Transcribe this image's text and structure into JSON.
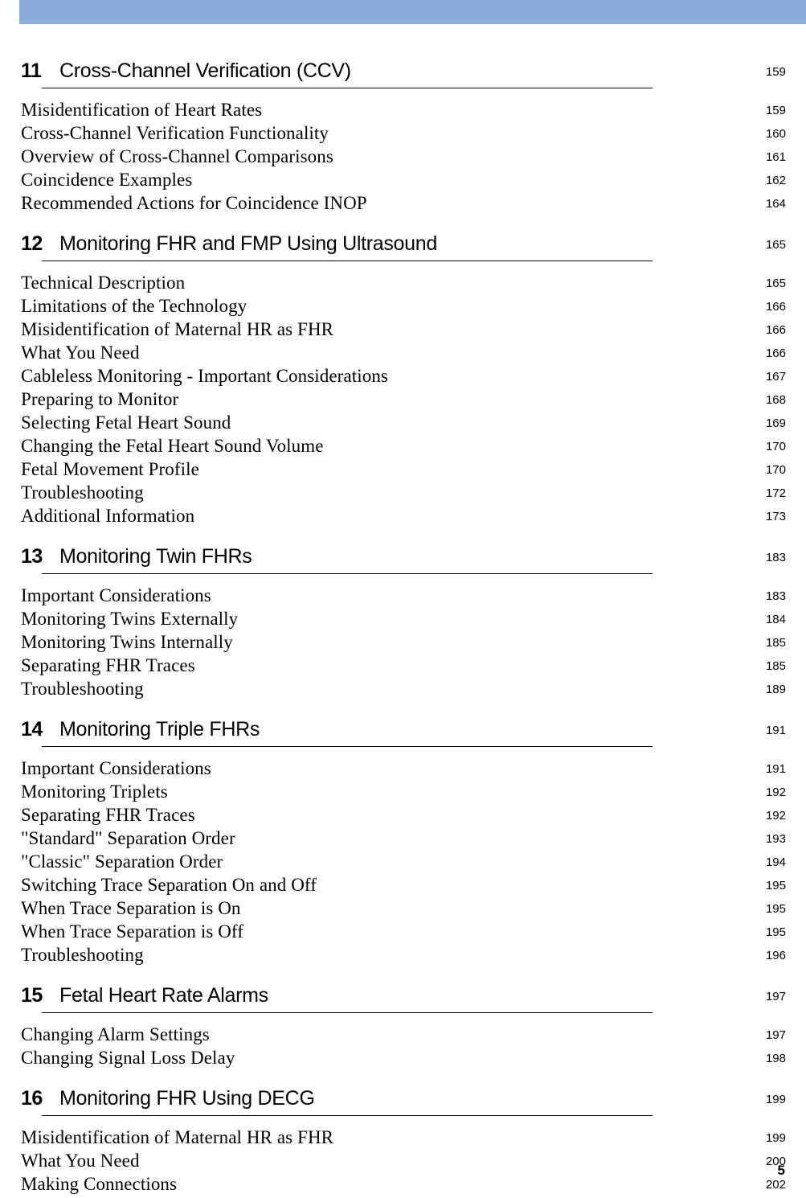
{
  "document": {
    "footer_page_number": "5",
    "header_band_color": "#8cacdc"
  },
  "toc": {
    "sections": [
      {
        "number": "11",
        "title": "Cross-Channel Verification (CCV)",
        "page": "159",
        "entries": [
          {
            "title": "Misidentification of Heart Rates",
            "page": "159"
          },
          {
            "title": "Cross-Channel Verification Functionality",
            "page": "160"
          },
          {
            "title": "Overview of Cross-Channel Comparisons",
            "page": "161"
          },
          {
            "title": "Coincidence Examples",
            "page": "162"
          },
          {
            "title": "Recommended Actions for Coincidence INOP",
            "page": "164"
          }
        ]
      },
      {
        "number": "12",
        "title": "Monitoring FHR and FMP Using Ultrasound",
        "page": "165",
        "entries": [
          {
            "title": "Technical Description",
            "page": "165"
          },
          {
            "title": "Limitations of the Technology",
            "page": "166"
          },
          {
            "title": "Misidentification of Maternal HR as FHR",
            "page": "166"
          },
          {
            "title": "What You Need",
            "page": "166"
          },
          {
            "title": "Cableless Monitoring - Important Considerations",
            "page": "167"
          },
          {
            "title": "Preparing to Monitor",
            "page": "168"
          },
          {
            "title": "Selecting Fetal Heart Sound",
            "page": "169"
          },
          {
            "title": "Changing the Fetal Heart Sound Volume",
            "page": "170"
          },
          {
            "title": "Fetal Movement Profile",
            "page": "170"
          },
          {
            "title": "Troubleshooting",
            "page": "172"
          },
          {
            "title": "Additional Information",
            "page": "173"
          }
        ]
      },
      {
        "number": "13",
        "title": "Monitoring Twin FHRs",
        "page": "183",
        "entries": [
          {
            "title": "Important Considerations",
            "page": "183"
          },
          {
            "title": "Monitoring Twins Externally",
            "page": "184"
          },
          {
            "title": "Monitoring Twins Internally",
            "page": "185"
          },
          {
            "title": "Separating FHR Traces",
            "page": "185"
          },
          {
            "title": "Troubleshooting",
            "page": "189"
          }
        ]
      },
      {
        "number": "14",
        "title": "Monitoring Triple FHRs",
        "page": "191",
        "entries": [
          {
            "title": "Important Considerations",
            "page": "191"
          },
          {
            "title": "Monitoring Triplets",
            "page": "192"
          },
          {
            "title": "Separating FHR Traces",
            "page": "192"
          },
          {
            "title": "\"Standard\" Separation Order",
            "page": "193"
          },
          {
            "title": "\"Classic\" Separation Order",
            "page": "194"
          },
          {
            "title": "Switching Trace Separation On and Off",
            "page": "195"
          },
          {
            "title": "When Trace Separation is On",
            "page": "195"
          },
          {
            "title": "When Trace Separation is Off",
            "page": "195"
          },
          {
            "title": "Troubleshooting",
            "page": "196"
          }
        ]
      },
      {
        "number": "15",
        "title": "Fetal Heart Rate Alarms",
        "page": "197",
        "entries": [
          {
            "title": "Changing Alarm Settings",
            "page": "197"
          },
          {
            "title": "Changing Signal Loss Delay",
            "page": "198"
          }
        ]
      },
      {
        "number": "16",
        "title": "Monitoring FHR Using DECG",
        "page": "199",
        "entries": [
          {
            "title": "Misidentification of Maternal HR as FHR",
            "page": "199"
          },
          {
            "title": "What You Need",
            "page": "200"
          },
          {
            "title": "Making Connections",
            "page": "202"
          }
        ]
      }
    ]
  }
}
